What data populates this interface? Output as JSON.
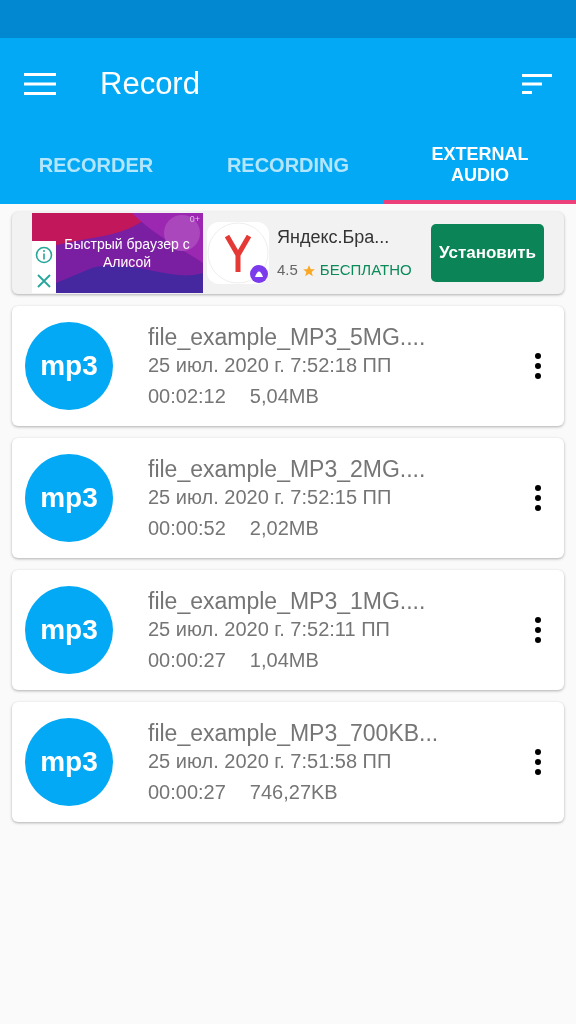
{
  "toolbar": {
    "title": "Record"
  },
  "tabs": [
    {
      "label": "RECORDER",
      "selected": false
    },
    {
      "label": "RECORDING",
      "selected": false
    },
    {
      "label": "EXTERNAL AUDIO",
      "selected": true
    }
  ],
  "ad": {
    "banner_text": "Быстрый браузер с Алисой",
    "age_rating": "0+",
    "app_name": "Яндекс.Бра...",
    "rating": "4.5",
    "price": "БЕСПЛАТНО",
    "install_button": "Установить"
  },
  "files": [
    {
      "format": "mp3",
      "name": "file_example_MP3_5MG....",
      "date": "25 июл. 2020 г. 7:52:18 ПП",
      "duration": "00:02:12",
      "size": "5,04MB"
    },
    {
      "format": "mp3",
      "name": "file_example_MP3_2MG....",
      "date": "25 июл. 2020 г. 7:52:15 ПП",
      "duration": "00:00:52",
      "size": "2,02MB"
    },
    {
      "format": "mp3",
      "name": "file_example_MP3_1MG....",
      "date": "25 июл. 2020 г. 7:52:11 ПП",
      "duration": "00:00:27",
      "size": "1,04MB"
    },
    {
      "format": "mp3",
      "name": "file_example_MP3_700KB...",
      "date": "25 июл. 2020 г. 7:51:58 ПП",
      "duration": "00:00:27",
      "size": "746,27KB"
    }
  ]
}
